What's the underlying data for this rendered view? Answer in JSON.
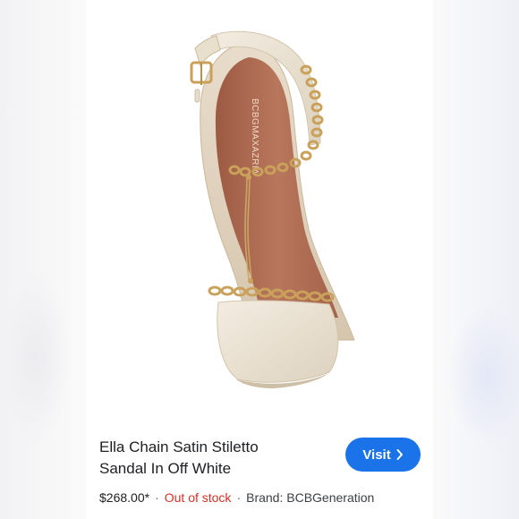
{
  "product": {
    "brand_imprint": "BCBGMAXAZRIA",
    "title_line1": "Ella Chain Satin Stiletto",
    "title_line2": "Sandal In Off White",
    "price": "$268.00*",
    "stock_status": "Out of stock",
    "brand_label": "Brand: BCBGeneration",
    "separator": "·"
  },
  "actions": {
    "visit_label": "Visit",
    "visit_icon": "chevron-right-icon"
  },
  "colors": {
    "visit_button": "#1a73e8",
    "out_of_stock": "#d93025",
    "insole": "#b5735a",
    "satin_strap": "#ece3d3",
    "gold_chain": "#c9a15a"
  }
}
